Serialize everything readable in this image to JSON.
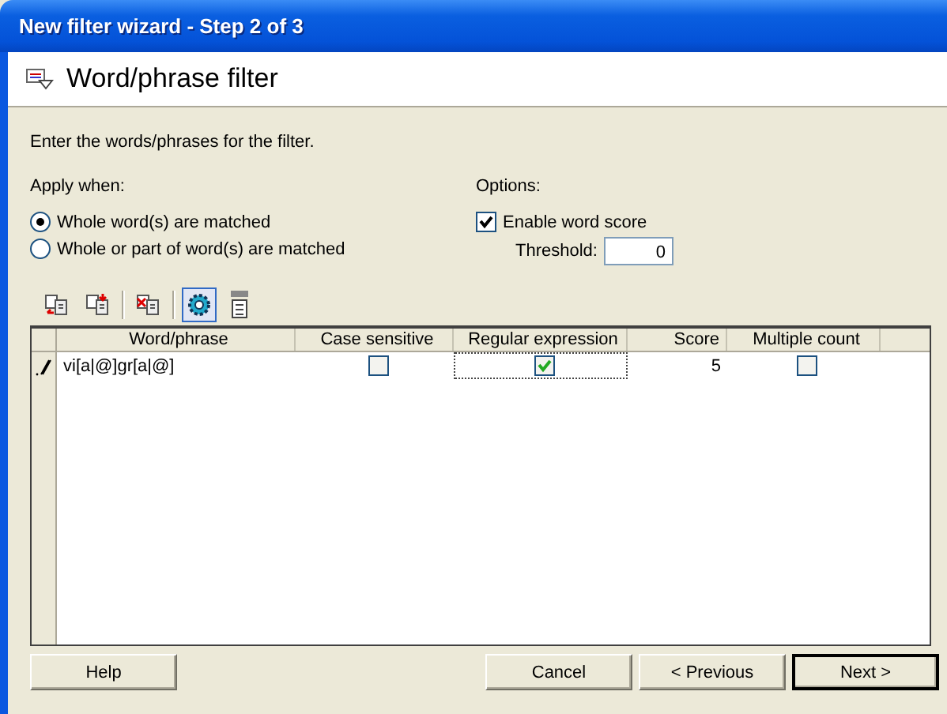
{
  "window": {
    "title": "New filter wizard - Step 2 of 3"
  },
  "header": {
    "title": "Word/phrase filter"
  },
  "instruction": "Enter the words/phrases for the filter.",
  "apply_when": {
    "label": "Apply when:",
    "options": [
      {
        "label": "Whole word(s) are matched",
        "selected": true
      },
      {
        "label": "Whole or part of word(s) are matched",
        "selected": false
      }
    ]
  },
  "options": {
    "label": "Options:",
    "enable_word_score": {
      "label": "Enable word score",
      "checked": true
    },
    "threshold": {
      "label": "Threshold:",
      "value": "0"
    }
  },
  "toolbar": [
    {
      "kind": "add",
      "pressed": false
    },
    {
      "kind": "remove",
      "pressed": false
    },
    {
      "kind": "copy",
      "pressed": false
    },
    {
      "kind": "regex",
      "pressed": true
    },
    {
      "kind": "spell",
      "pressed": false
    }
  ],
  "grid": {
    "columns": [
      "Word/phrase",
      "Case sensitive",
      "Regular expression",
      "Score",
      "Multiple count"
    ],
    "rows": [
      {
        "editing": true,
        "word": "vi[a|@]gr[a|@]",
        "case_sensitive": false,
        "regular_expression": true,
        "score": "5",
        "multiple_count": false
      }
    ]
  },
  "buttons": {
    "help": "Help",
    "cancel": "Cancel",
    "previous": "< Previous",
    "next": "Next >"
  }
}
